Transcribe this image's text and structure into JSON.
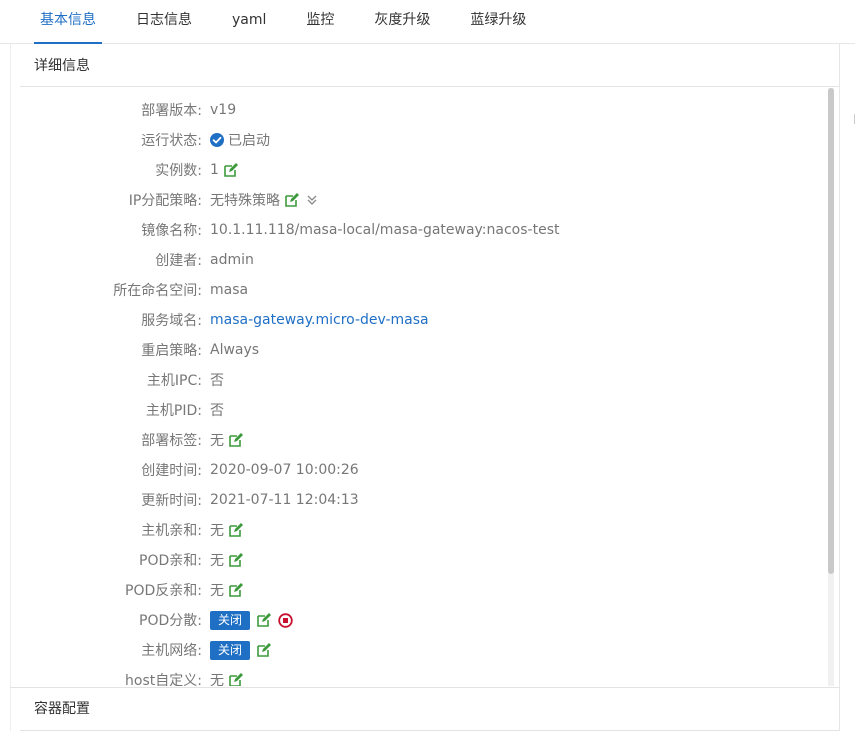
{
  "tabs": [
    {
      "label": "基本信息",
      "active": true
    },
    {
      "label": "日志信息",
      "active": false
    },
    {
      "label": "yaml",
      "active": false
    },
    {
      "label": "监控",
      "active": false
    },
    {
      "label": "灰度升级",
      "active": false
    },
    {
      "label": "蓝绿升级",
      "active": false
    }
  ],
  "detail_section": {
    "title": "详细信息"
  },
  "container_section": {
    "title": "容器配置"
  },
  "fields": {
    "deploy_version": {
      "label": "部署版本:",
      "value": "v19"
    },
    "run_status": {
      "label": "运行状态:",
      "value": "已启动",
      "icon": "check-circle-icon"
    },
    "instances": {
      "label": "实例数:",
      "value": "1"
    },
    "ip_policy": {
      "label": "IP分配策略:",
      "value": "无特殊策略"
    },
    "image_name": {
      "label": "镜像名称:",
      "value": "10.1.11.118/masa-local/masa-gateway:nacos-test"
    },
    "creator": {
      "label": "创建者:",
      "value": "admin"
    },
    "namespace": {
      "label": "所在命名空间:",
      "value": "masa"
    },
    "service_domain": {
      "label": "服务域名:",
      "value": "masa-gateway.micro-dev-masa"
    },
    "restart_policy": {
      "label": "重启策略:",
      "value": "Always"
    },
    "host_ipc": {
      "label": "主机IPC:",
      "value": "否"
    },
    "host_pid": {
      "label": "主机PID:",
      "value": "否"
    },
    "deploy_labels": {
      "label": "部署标签:",
      "value": "无"
    },
    "created_time": {
      "label": "创建时间:",
      "value": "2020-09-07 10:00:26"
    },
    "updated_time": {
      "label": "更新时间:",
      "value": "2021-07-11 12:04:13"
    },
    "host_affinity": {
      "label": "主机亲和:",
      "value": "无"
    },
    "pod_affinity": {
      "label": "POD亲和:",
      "value": "无"
    },
    "pod_anti_affinity": {
      "label": "POD反亲和:",
      "value": "无"
    },
    "pod_spread": {
      "label": "POD分散:",
      "button": "关闭"
    },
    "host_network": {
      "label": "主机网络:",
      "button": "关闭"
    },
    "host_custom": {
      "label": "host自定义:",
      "value": "无"
    }
  },
  "colors": {
    "accent": "#1f6fc5",
    "edit_icon": "#3c9a3c",
    "stop_icon": "#c8102e"
  }
}
